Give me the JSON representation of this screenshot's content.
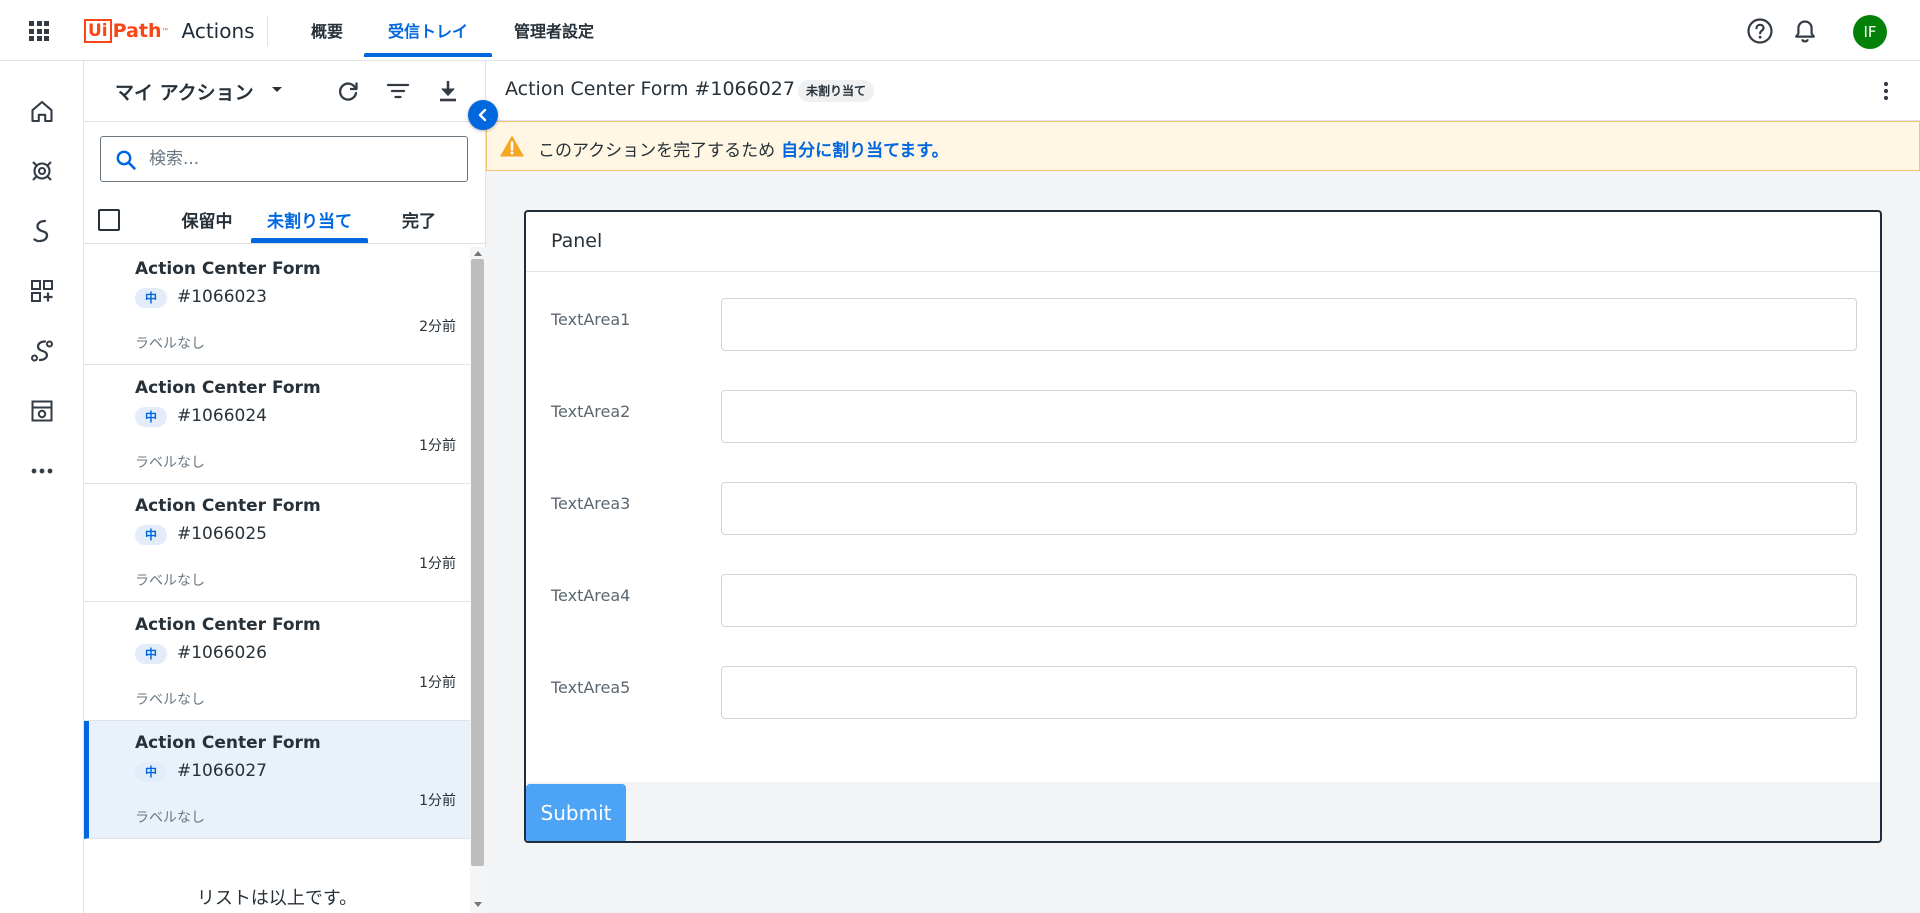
{
  "header": {
    "logo_ui": "Ui",
    "logo_path": "Path",
    "logo_tm": "™",
    "app_name": "Actions",
    "tabs": [
      {
        "label": "概要",
        "active": false
      },
      {
        "label": "受信トレイ",
        "active": true
      },
      {
        "label": "管理者設定",
        "active": false
      }
    ],
    "icons": [
      "apps-grid-icon",
      "help-icon",
      "bell-icon"
    ],
    "avatar_initials": "IF",
    "colors": {
      "brand": "#fa4616",
      "accent": "#0067df",
      "avatar": "#038108"
    }
  },
  "rail": {
    "icons": [
      "home-icon",
      "process-icon",
      "automation-icon",
      "apps-icon",
      "integration-icon",
      "store-icon",
      "more-icon"
    ]
  },
  "list": {
    "title": "マイ アクション",
    "tools": [
      "refresh-icon",
      "filter-icon",
      "download-icon"
    ],
    "search": {
      "placeholder": "検索..."
    },
    "tabs": [
      {
        "label": "保留中",
        "active": false
      },
      {
        "label": "未割り当て",
        "active": true
      },
      {
        "label": "完了",
        "active": false
      }
    ],
    "items": [
      {
        "title": "Action Center Form",
        "priority": "中",
        "id": "#1066023",
        "time": "2分前",
        "label": "ラベルなし",
        "selected": false
      },
      {
        "title": "Action Center Form",
        "priority": "中",
        "id": "#1066024",
        "time": "1分前",
        "label": "ラベルなし",
        "selected": false
      },
      {
        "title": "Action Center Form",
        "priority": "中",
        "id": "#1066025",
        "time": "1分前",
        "label": "ラベルなし",
        "selected": false
      },
      {
        "title": "Action Center Form",
        "priority": "中",
        "id": "#1066026",
        "time": "1分前",
        "label": "ラベルなし",
        "selected": false
      },
      {
        "title": "Action Center Form",
        "priority": "中",
        "id": "#1066027",
        "time": "1分前",
        "label": "ラベルなし",
        "selected": true
      }
    ],
    "end_text": "リストは以上です。"
  },
  "main": {
    "title": "Action Center Form #1066027",
    "status_badge": "未割り当て",
    "alert": {
      "text": "このアクションを完了するため",
      "link": "自分に割り当てます。",
      "color": "#f5a623"
    },
    "panel": {
      "title": "Panel",
      "fields": [
        {
          "label": "TextArea1",
          "value": ""
        },
        {
          "label": "TextArea2",
          "value": ""
        },
        {
          "label": "TextArea3",
          "value": ""
        },
        {
          "label": "TextArea4",
          "value": ""
        },
        {
          "label": "TextArea5",
          "value": ""
        }
      ],
      "submit_label": "Submit"
    }
  }
}
